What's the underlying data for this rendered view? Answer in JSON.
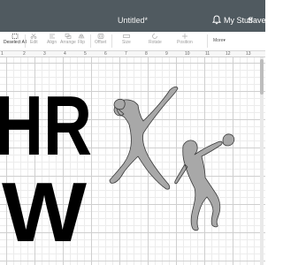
{
  "header": {
    "title": "Untitled*",
    "my_stuff_label": "My Stuff",
    "save_label": "Save"
  },
  "toolbar": {
    "tools": [
      {
        "label": "Deselect All",
        "active": true
      },
      {
        "label": "Edit",
        "active": false
      },
      {
        "label": "Align",
        "active": false
      },
      {
        "label": "Arrange",
        "active": false
      },
      {
        "label": "Flip",
        "active": false
      },
      {
        "label": "Offset",
        "active": false
      },
      {
        "label": "Size",
        "active": false
      },
      {
        "label": "Rotate",
        "active": false
      },
      {
        "label": "Position",
        "active": false
      }
    ],
    "more_label": "More▾"
  },
  "ruler": {
    "ticks": [
      "1",
      "2",
      "3",
      "4",
      "5",
      "6",
      "7",
      "8",
      "9",
      "10",
      "11",
      "12",
      "13"
    ]
  },
  "canvas": {
    "text_objects": [
      {
        "text": "HR",
        "color": "#000000"
      },
      {
        "text": "W",
        "color": "#000000"
      }
    ],
    "shape_objects": [
      {
        "name": "shot-put-thrower-silhouette",
        "color": "#a8a8a8",
        "stroke": "#3a3a3a"
      },
      {
        "name": "discus-thrower-silhouette",
        "color": "#a8a8a8",
        "stroke": "#3a3a3a"
      }
    ]
  },
  "colors": {
    "titlebar": "#505a60",
    "silhouette_fill": "#a8a8a8",
    "text_fill": "#000000"
  }
}
